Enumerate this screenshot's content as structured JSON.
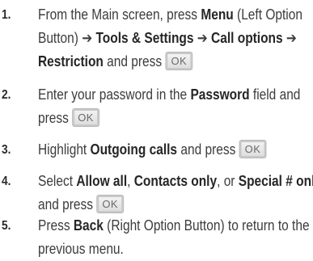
{
  "steps": [
    {
      "number": "1.",
      "line1": {
        "a": "From the Main screen, press ",
        "b": "Menu",
        "c": " (Left Option"
      },
      "line2": {
        "a": "Button) ➔ ",
        "b": "Tools & Settings",
        "c": " ➔ ",
        "d": "Call options",
        "e": " ➔"
      },
      "line3": {
        "a": "Restriction",
        "b": " and press "
      }
    },
    {
      "number": "2.",
      "line1": {
        "a": "Enter your password in the ",
        "b": "Password",
        "c": " field and"
      },
      "line2": {
        "a": "press "
      }
    },
    {
      "number": "3.",
      "line1": {
        "a": "Highlight ",
        "b": "Outgoing calls",
        "c": " and press "
      }
    },
    {
      "number": "4.",
      "line1": {
        "a": "Select ",
        "b": "Allow all",
        "c": ", ",
        "d": "Contacts only",
        "e": ", or ",
        "f": "Special # only"
      },
      "line2": {
        "a": "and press "
      }
    },
    {
      "number": "5.",
      "line1": {
        "a": "Press ",
        "b": "Back",
        "c": " (Right Option Button) to return to the"
      },
      "line2": {
        "a": "previous menu."
      }
    }
  ],
  "ok_button": {
    "label": "OK"
  }
}
